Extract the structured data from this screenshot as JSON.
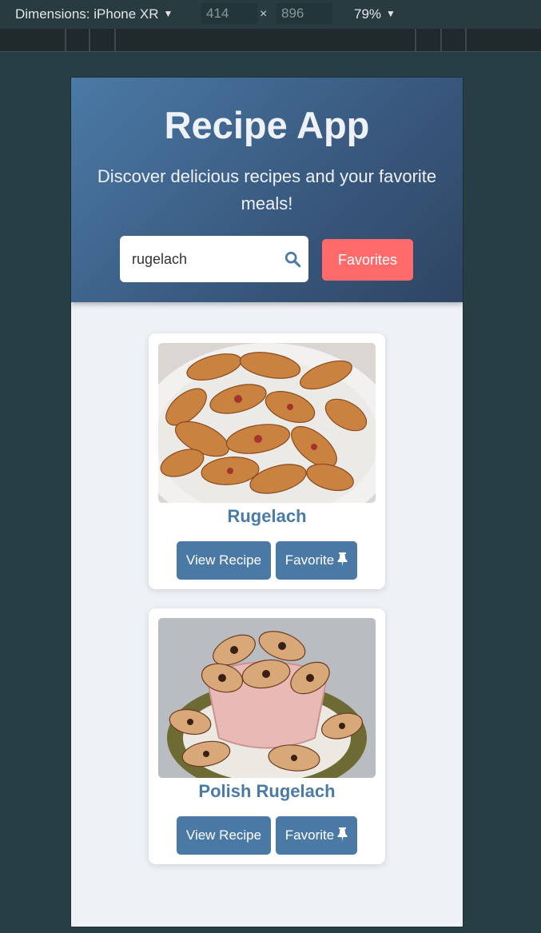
{
  "devtools": {
    "dimensions_label": "Dimensions: iPhone XR",
    "width": "414",
    "height": "896",
    "times": "×",
    "zoom": "79%"
  },
  "header": {
    "title": "Recipe App",
    "tagline": "Discover delicious recipes and your favorite meals!",
    "search_value": "rugelach",
    "favorites_label": "Favorites"
  },
  "recipes": [
    {
      "title": "Rugelach",
      "view_label": "View Recipe",
      "favorite_label": "Favorite"
    },
    {
      "title": "Polish Rugelach",
      "view_label": "View Recipe",
      "favorite_label": "Favorite"
    }
  ],
  "colors": {
    "header_start": "#4a7aa6",
    "header_end": "#2e4563",
    "accent_button": "#ff6b6b",
    "primary_button": "#4a79a6",
    "card_title": "#4a7aa6",
    "page_bg": "#eef1f6"
  },
  "icons": {
    "search": "search-icon",
    "pin": "pin-icon",
    "dropdown": "caret-down-icon"
  }
}
